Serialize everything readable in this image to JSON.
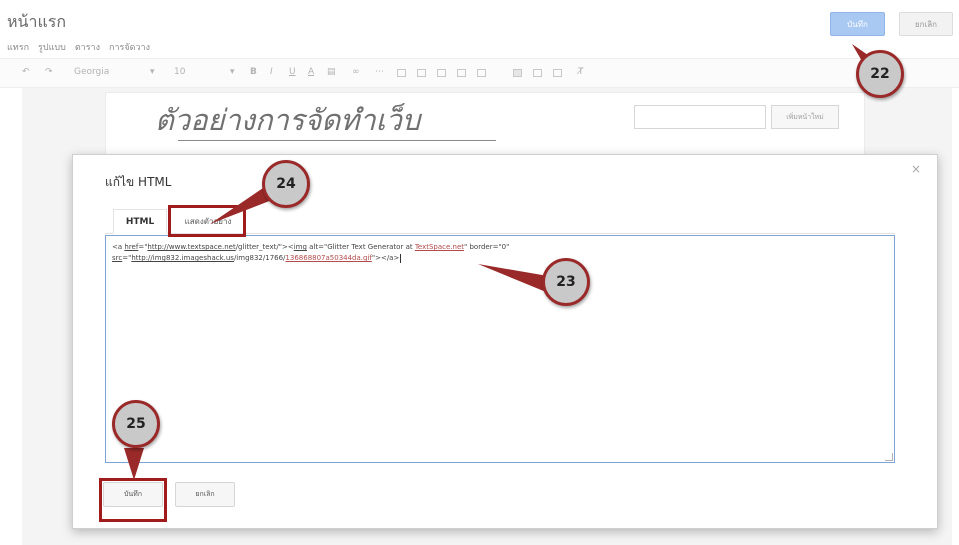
{
  "page": {
    "title": "หน้าแรก"
  },
  "menu": [
    "แทรก",
    "รูปแบบ",
    "ตาราง",
    "การจัดวาง"
  ],
  "top_buttons": {
    "save_label": "บันทึก",
    "cancel_label": "ยกเลิก"
  },
  "toolbar": {
    "font_name": "Georgia",
    "font_size": "10"
  },
  "blog": {
    "heading": "ตัวอย่างการจัดทำเว็บ",
    "search_button": "เพิ่มหน้าใหม่"
  },
  "dialog": {
    "title": "แก้ไข HTML",
    "close_glyph": "×",
    "tabs": [
      "HTML",
      "แสดงตัวอย่าง"
    ],
    "code_line1_a": "<a ",
    "code_line1_href": "href",
    "code_line1_b": "=\"",
    "code_line1_url": "http://www.textspace.net",
    "code_line1_c": "/glitter_text/\"><",
    "code_line1_img": "img",
    "code_line1_d": " alt=\"Glitter Text Generator at ",
    "code_line1_site": "TextSpace.net",
    "code_line1_e": "\" border=\"0\"",
    "code_line2_a": "src",
    "code_line2_b": "=\"",
    "code_line2_url": "http://img832.imageshack.us",
    "code_line2_c": "/img832/1766/",
    "code_line2_file": "136868807a50344da.gif",
    "code_line2_d": "\"></a>",
    "save_label": "บันทึก",
    "cancel_label": "ยกเลิก"
  },
  "callouts": {
    "c22": "22",
    "c23": "23",
    "c24": "24",
    "c25": "25"
  },
  "colors": {
    "callout_fill": "#c9c9c9",
    "callout_border": "#9a2a2a",
    "highlight": "#a01c1c",
    "primary_button": "#a9c8f2",
    "textarea_border": "#7ea3d6"
  }
}
